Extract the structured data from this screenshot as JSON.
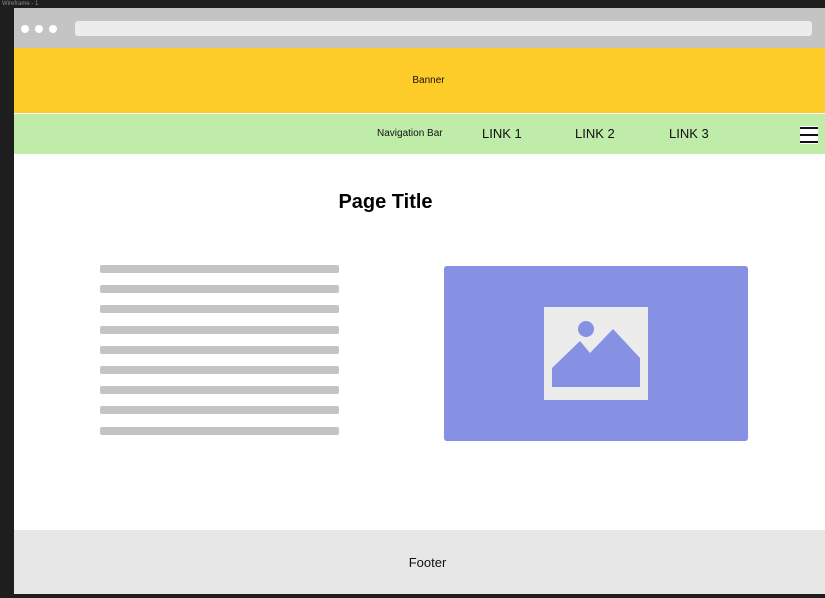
{
  "frame": {
    "label": "Wireframe - 1"
  },
  "banner": {
    "text": "Banner",
    "color": "#fecc28"
  },
  "navigation": {
    "label": "Navigation Bar",
    "color": "#c0ecaa",
    "links": [
      "LINK 1",
      "LINK 2",
      "LINK 3"
    ],
    "menu_icon": "hamburger-menu-icon"
  },
  "page": {
    "title": "Page Title"
  },
  "image_placeholder": {
    "icon": "image-placeholder-icon",
    "color": "#8691e3"
  },
  "footer": {
    "text": "Footer"
  }
}
